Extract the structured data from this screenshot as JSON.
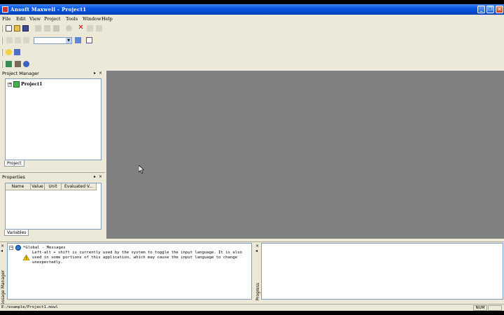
{
  "window": {
    "title": "Ansoft Maxwell - Project1"
  },
  "menu": [
    "File",
    "Edit",
    "View",
    "Project",
    "Tools",
    "Window",
    "Help"
  ],
  "project_manager": {
    "title": "Project Manager",
    "tree_root": "Project1",
    "tab": "Project"
  },
  "properties": {
    "title": "Properties",
    "columns": [
      "Name",
      "Value",
      "Unit",
      "Evaluated V..."
    ],
    "tab": "Variables"
  },
  "messages": {
    "side_label": "Message Manager",
    "group": "*Global - Messages",
    "lines": [
      "Left-alt + shift is currently used by the system to toggle the input language. It is also",
      "used in some portions of this application, which may cause the input language to change",
      "unexpectedly."
    ]
  },
  "progress": {
    "side_label": "Progress"
  },
  "status": {
    "path": "E:/example/Project1.mxwl",
    "num": "NUM"
  },
  "colors": {
    "title_bar": "#0a55e0",
    "workspace": "#808080",
    "chrome": "#ece9d8"
  }
}
